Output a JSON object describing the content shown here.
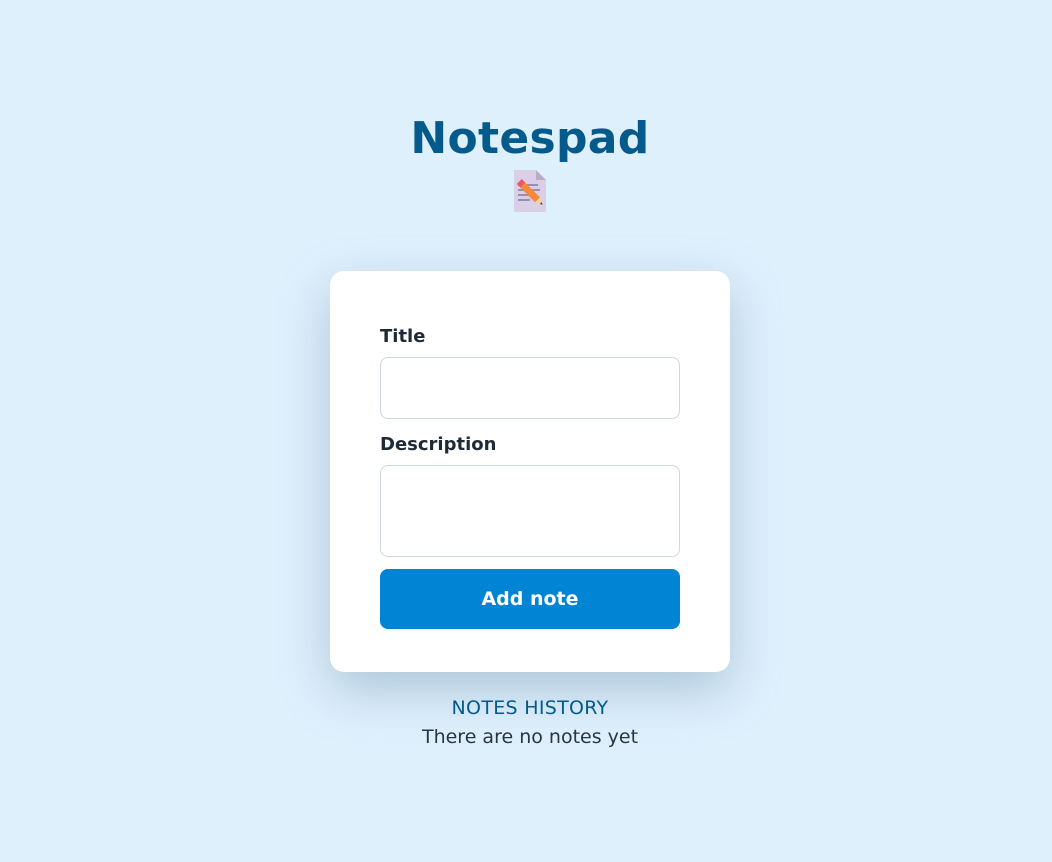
{
  "header": {
    "title": "Notespad",
    "icon": "memo-pencil-icon"
  },
  "form": {
    "title_label": "Title",
    "title_value": "",
    "title_placeholder": "",
    "description_label": "Description",
    "description_value": "",
    "description_placeholder": "",
    "submit_label": "Add note"
  },
  "history": {
    "heading": "NOTES HISTORY",
    "empty_message": "There are no notes yet"
  },
  "colors": {
    "background": "#dff0fd",
    "accent": "#0284d4",
    "heading": "#045a8a",
    "card": "#ffffff"
  }
}
